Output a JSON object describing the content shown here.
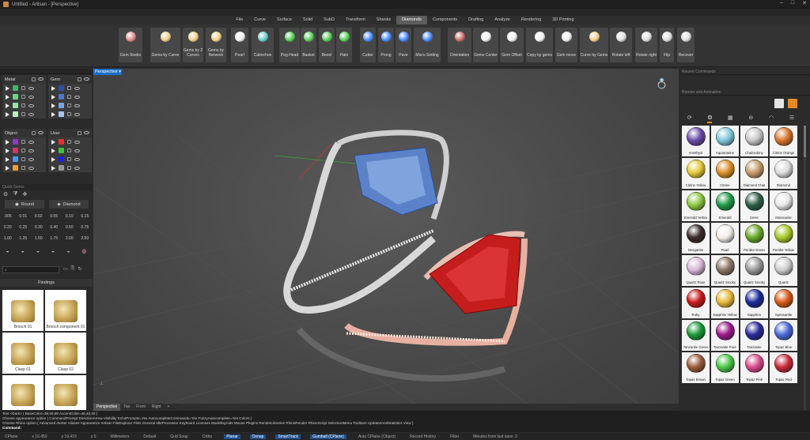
{
  "window": {
    "title": "Untitled - Artisan - [Perspective]"
  },
  "menu_tabs": [
    "File",
    "Curve",
    "Surface",
    "Solid",
    "SubD",
    "Transform",
    "Shanks",
    "Diamonds",
    "Components",
    "Drafting",
    "Analyze",
    "Rendering",
    "3D Printing"
  ],
  "active_tab": "Diamonds",
  "ribbon": [
    {
      "label": "Gem Studio"
    },
    {
      "label": "Gems by Curve"
    },
    {
      "label": "Gems by 2\nCurves"
    },
    {
      "label": "Gems by\nNetwork"
    },
    {
      "label": "Pearl"
    },
    {
      "label": "Cabochon"
    },
    {
      "label": "Peg Head"
    },
    {
      "label": "Basket"
    },
    {
      "label": "Bezel"
    },
    {
      "label": "Halo"
    },
    {
      "label": "Cutter"
    },
    {
      "label": "Prong"
    },
    {
      "label": "Pave"
    },
    {
      "label": "Micro Setting"
    },
    {
      "label": "Orientation"
    },
    {
      "label": "Gems Center"
    },
    {
      "label": "Gem Offset"
    },
    {
      "label": "Copy by gems"
    },
    {
      "label": "Gem move"
    },
    {
      "label": "Curve by Gems"
    },
    {
      "label": "Rotate left"
    },
    {
      "label": "Rotate right"
    },
    {
      "label": "Flip"
    },
    {
      "label": "Recover"
    }
  ],
  "layers": {
    "metal": {
      "title": "Metal",
      "colors": [
        "#4caf6e",
        "#6fd18a",
        "#98e3a8",
        "#bdeec5"
      ]
    },
    "gem": {
      "title": "Gem",
      "colors": [
        "#2b4fa8",
        "#4b78cf",
        "#7aa3e6",
        "#a9c6f2"
      ]
    },
    "object": {
      "title": "Object",
      "colors": [
        "#8a3fb8",
        "#c23b6b",
        "#4a9be8",
        "#e8a040"
      ]
    },
    "user": {
      "title": "User",
      "colors": [
        "#e83030",
        "#3ac43a",
        "#2020e0",
        "#999999"
      ]
    }
  },
  "quick_gems": {
    "title": "Quick Gems",
    "shape1": "Round",
    "shape2": "Diamond",
    "sizes": [
      ".005",
      "0.01",
      "0.02",
      "0.05",
      "0.10",
      "0.15",
      "0.20",
      "0.25",
      "0.30",
      "0.40",
      "0.50",
      "0.75",
      "1.00",
      "1.25",
      "1.50",
      "1.75",
      "2.00",
      "2.50"
    ]
  },
  "findings": {
    "title": "Findings",
    "items": [
      "Brooch 01",
      "Brooch component 01",
      "Clasp 01",
      "Clasp 02"
    ]
  },
  "viewport": {
    "label": "Perspective",
    "tabs": [
      "Perspective",
      "Top",
      "Front",
      "Right",
      "+"
    ],
    "active": "Perspective"
  },
  "right_panel": {
    "recent": "Recent Commands",
    "render": "Render and Animation"
  },
  "gems": [
    {
      "name": "Amethyst",
      "color": "#6a4ba8"
    },
    {
      "name": "Aquamarine",
      "color": "#7fc8d8"
    },
    {
      "name": "Chalcedony",
      "color": "#c7c7c7"
    },
    {
      "name": "Citrine Orange",
      "color": "#d9732a"
    },
    {
      "name": "Citrine Yellow",
      "color": "#e5c93a"
    },
    {
      "name": "Citrine",
      "color": "#d9902a"
    },
    {
      "name": "Diamond Chat",
      "color": "#c49a6a"
    },
    {
      "name": "Diamond",
      "color": "#dddddd"
    },
    {
      "name": "Emerald Yellow",
      "color": "#8cc840"
    },
    {
      "name": "Emerald",
      "color": "#1f9a48"
    },
    {
      "name": "Green",
      "color": "#2d5e45"
    },
    {
      "name": "Moissanite",
      "color": "#e8e8e8"
    },
    {
      "name": "Morganite",
      "color": "#3a2a2a"
    },
    {
      "name": "Pearl",
      "color": "#f2efe8"
    },
    {
      "name": "Peridot Green",
      "color": "#6aa82a"
    },
    {
      "name": "Peridot Yellow",
      "color": "#a8c82a"
    },
    {
      "name": "Quartz Rose",
      "color": "#d8b8d8"
    },
    {
      "name": "Quartz Smoky",
      "color": "#8a7565"
    },
    {
      "name": "Quartz Smoky",
      "color": "#9a9a9a"
    },
    {
      "name": "Quartz",
      "color": "#cfcfcf"
    },
    {
      "name": "Ruby",
      "color": "#c81a1a"
    },
    {
      "name": "Sapphire Yellow",
      "color": "#e5b83a"
    },
    {
      "name": "Sapphire",
      "color": "#1a2a9a"
    },
    {
      "name": "Spessartite",
      "color": "#d85a1a"
    },
    {
      "name": "Tanzanite Green",
      "color": "#1a9a3a"
    },
    {
      "name": "Tanzanite Pure",
      "color": "#9a1a8a"
    },
    {
      "name": "Tanzanite",
      "color": "#2a2a9a"
    },
    {
      "name": "Topaz Blue",
      "color": "#4a6ad8"
    },
    {
      "name": "Topaz Brown",
      "color": "#9a5a3a"
    },
    {
      "name": "Topaz Green",
      "color": "#4ac84a"
    },
    {
      "name": "Topaz Pink",
      "color": "#d84a8a"
    },
    {
      "name": "Topaz Red",
      "color": "#c82a3a"
    }
  ],
  "command_history": [
    "Text <Dark> ( BaseColor=38,50,58 AccentColor=48,40,40 )",
    "Choose appearance option ( CommandPrompt DirectionArrow Visibility EchoPrompts=Yes AutocompleteCommands=Yes FuzzyAutocomplete=Yes Colors )",
    "Choose Rhino option ( Advanced Alerter Aliases Appearance Artisan FileExplorer Files General IdleProcessor Keyboard Licenses ModelingAids Mouse Plugins RenderLibraries RhinoRender RhinoScript SelectionMenu Toolbars UpdatesAndStatistics View )",
    "Command:"
  ],
  "status": {
    "items": [
      "CPlane",
      "x 16.450",
      "y 19.415",
      "z 0",
      "Millimeters",
      "Default",
      "Grid Snap",
      "Ortho",
      "Planar",
      "Osnap",
      "SmartTrack",
      "Gumball (CPlane)",
      "Auto CPlane (Object)",
      "Record History",
      "Filter",
      "Minutes from last save: 3"
    ]
  }
}
